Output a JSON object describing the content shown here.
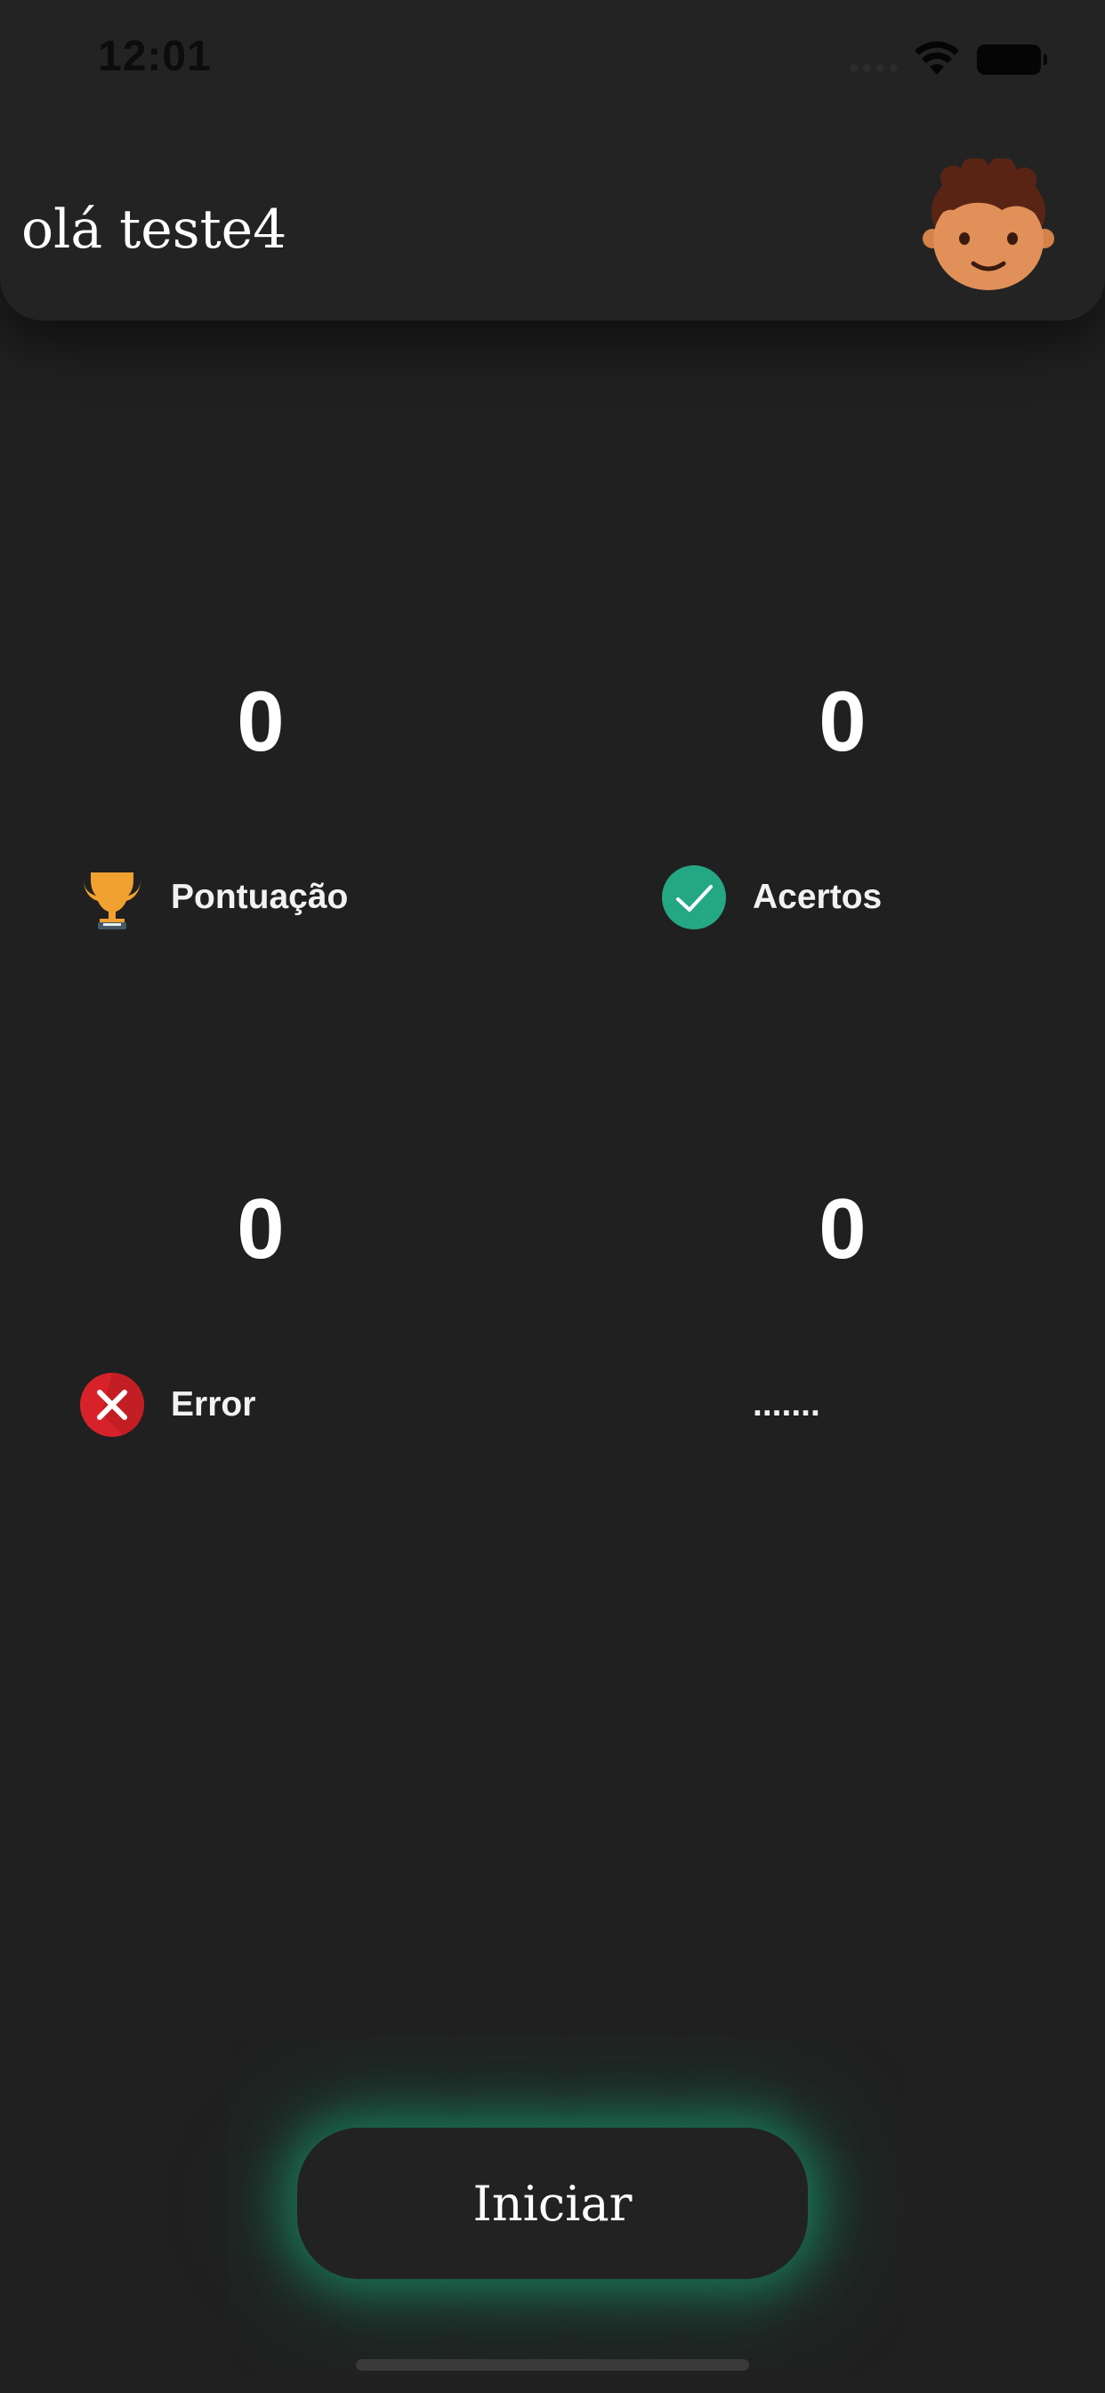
{
  "status_bar": {
    "time": "12:01"
  },
  "header": {
    "greeting": "olá teste4",
    "avatar_icon": "boy-face-icon"
  },
  "stats": [
    {
      "value": "0",
      "label": "Pontuação",
      "icon": "trophy-icon"
    },
    {
      "value": "0",
      "label": "Acertos",
      "icon": "check-circle-icon",
      "color": "#24a884"
    },
    {
      "value": "0",
      "label": "Error",
      "icon": "x-circle-icon",
      "color": "#d8222a"
    },
    {
      "value": "0",
      "label": "......."
    }
  ],
  "actions": {
    "start_label": "Iniciar",
    "glow_color": "#18a878"
  },
  "theme": {
    "background": "#202020",
    "header": "#232323"
  }
}
